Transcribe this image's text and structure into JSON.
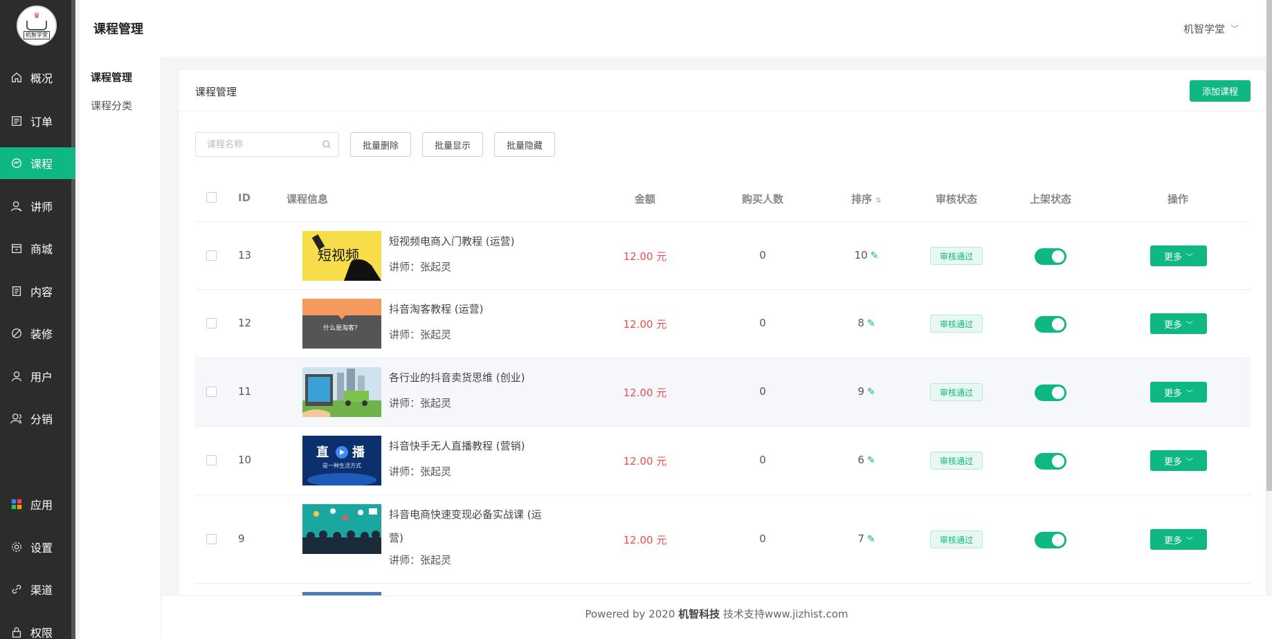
{
  "sidebar": {
    "logo_text": "机智学堂",
    "items": [
      {
        "label": "概况",
        "icon": "home-icon"
      },
      {
        "label": "订单",
        "icon": "order-icon"
      },
      {
        "label": "课程",
        "icon": "course-icon",
        "active": true
      },
      {
        "label": "讲师",
        "icon": "teacher-icon"
      },
      {
        "label": "商城",
        "icon": "shop-icon"
      },
      {
        "label": "内容",
        "icon": "content-icon"
      },
      {
        "label": "装修",
        "icon": "decoration-icon"
      },
      {
        "label": "用户",
        "icon": "user-icon"
      },
      {
        "label": "分销",
        "icon": "distribution-icon"
      },
      {
        "label": "应用",
        "icon": "apps-icon"
      },
      {
        "label": "设置",
        "icon": "settings-icon"
      },
      {
        "label": "渠道",
        "icon": "channel-icon"
      },
      {
        "label": "权限",
        "icon": "permission-icon"
      }
    ]
  },
  "header": {
    "title": "课程管理",
    "user": "机智学堂"
  },
  "subnav": {
    "items": [
      "课程管理",
      "课程分类"
    ]
  },
  "card": {
    "title": "课程管理",
    "add_button": "添加课程"
  },
  "toolbar": {
    "search_placeholder": "课程名称",
    "batch_delete": "批量删除",
    "batch_show": "批量显示",
    "batch_hide": "批量隐藏"
  },
  "table": {
    "headers": {
      "id": "ID",
      "info": "课程信息",
      "price": "金额",
      "buyers": "购买人数",
      "sort": "排序",
      "review": "审核状态",
      "listing": "上架状态",
      "action": "操作"
    },
    "rows": [
      {
        "id": "13",
        "name": "短视频电商入门教程 (运营)",
        "teacher": "讲师：张起灵",
        "price": "12.00 元",
        "buyers": "0",
        "sort": "10",
        "review": "审核通过",
        "listed": true,
        "action": "更多"
      },
      {
        "id": "12",
        "name": "抖音淘客教程 (运营)",
        "teacher": "讲师：张起灵",
        "price": "12.00 元",
        "buyers": "0",
        "sort": "8",
        "review": "审核通过",
        "listed": true,
        "action": "更多"
      },
      {
        "id": "11",
        "name": "各行业的抖音卖货思维 (创业)",
        "teacher": "讲师：张起灵",
        "price": "12.00 元",
        "buyers": "0",
        "sort": "9",
        "review": "审核通过",
        "listed": true,
        "action": "更多"
      },
      {
        "id": "10",
        "name": "抖音快手无人直播教程 (营销)",
        "teacher": "讲师：张起灵",
        "price": "12.00 元",
        "buyers": "0",
        "sort": "6",
        "review": "审核通过",
        "listed": true,
        "action": "更多"
      },
      {
        "id": "9",
        "name": "抖音电商快速变现必备实战课 (运营)",
        "teacher": "讲师：张起灵",
        "price": "12.00 元",
        "buyers": "0",
        "sort": "7",
        "review": "审核通过",
        "listed": true,
        "action": "更多"
      }
    ],
    "thumb_texts": {
      "t13": "短视频",
      "t12": "什么是淘客？",
      "t10_a": "直",
      "t10_b": "播",
      "t10_c": "是一种生活方式"
    }
  },
  "footer": {
    "prefix": "Powered by 2020 ",
    "company": "机智科技",
    "suffix": " 技术支持www.jizhist.com"
  },
  "colors": {
    "accent": "#0fb882",
    "price": "#ea4e4e",
    "sidebar_bg": "#2c2c2c"
  }
}
